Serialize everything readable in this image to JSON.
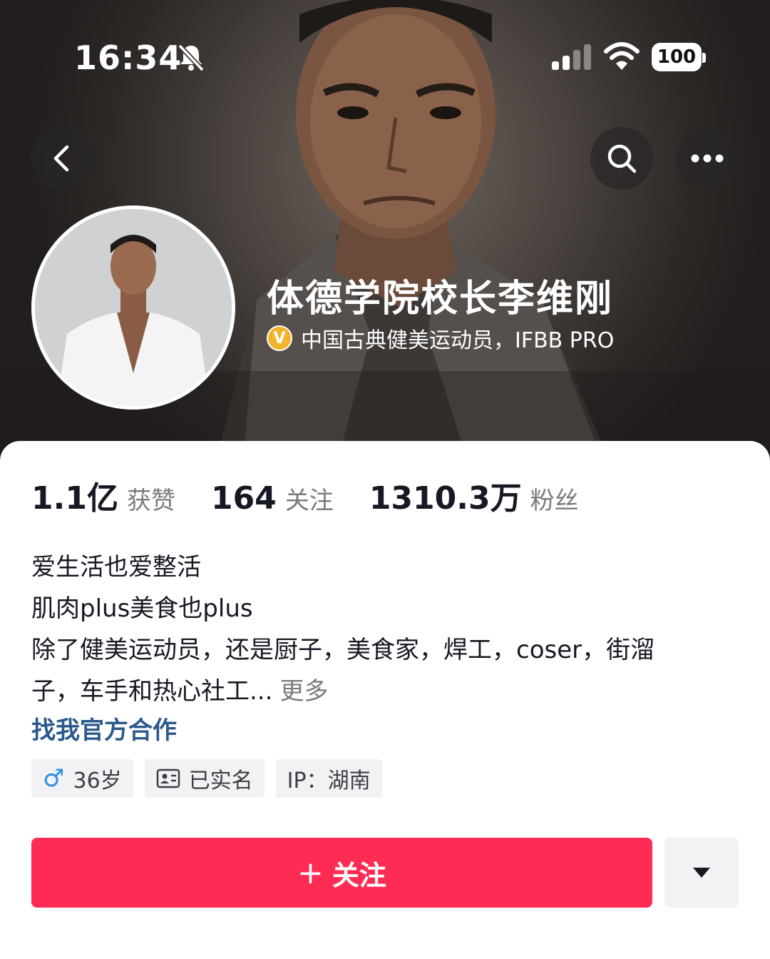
{
  "status_bar": {
    "time": "16:34",
    "battery": "100",
    "icons": [
      "bell-muted-icon",
      "cellular-signal-icon",
      "wifi-icon",
      "battery-icon"
    ]
  },
  "nav": {
    "icons": [
      "back-arrow-icon",
      "search-icon",
      "more-dots-icon"
    ]
  },
  "profile": {
    "name": "体德学院校长李维刚",
    "verified_badge": "V",
    "verification": "中国古典健美运动员，IFBB PRO"
  },
  "stats": [
    {
      "value": "1.1亿",
      "label": "获赞"
    },
    {
      "value": "164",
      "label": "关注"
    },
    {
      "value": "1310.3万",
      "label": "粉丝"
    }
  ],
  "bio": {
    "lines": [
      "爱生活也爱整活",
      "肌肉plus美食也plus",
      "除了健美运动员，还是厨子，美食家，焊工，coser，街溜",
      "子，车手和热心社工..."
    ],
    "more": "更多",
    "cooperation_link": "找我官方合作"
  },
  "tags": {
    "gender_symbol": "♂",
    "age": "36岁",
    "real_name": "已实名",
    "ip": "IP：湖南"
  },
  "actions": {
    "follow_plus": "+",
    "follow": "关注"
  },
  "colors": {
    "accent": "#fe2c55",
    "link": "#2c5a8c",
    "verify_badge": "#f3b32a",
    "gender": "#2f8fe6"
  }
}
